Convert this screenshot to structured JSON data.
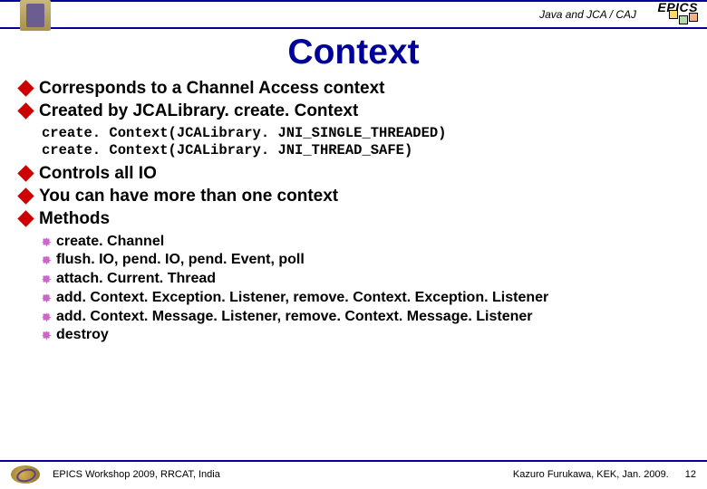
{
  "header": {
    "subtitle": "Java and JCA / CAJ",
    "badge": "EPICS"
  },
  "title": "Context",
  "bullets1a": [
    "Corresponds to a Channel Access context",
    "Created by JCALibrary. create. Context"
  ],
  "code": [
    "create. Context(JCALibrary. JNI_SINGLE_THREADED)",
    "create. Context(JCALibrary. JNI_THREAD_SAFE)"
  ],
  "bullets1b": [
    "Controls all IO",
    "You can have more than one context",
    "Methods"
  ],
  "bullets2": [
    "create. Channel",
    "flush. IO, pend. IO, pend. Event, poll",
    "attach. Current. Thread",
    "add. Context. Exception. Listener, remove. Context. Exception. Listener",
    "add. Context. Message. Listener, remove. Context. Message. Listener",
    "destroy"
  ],
  "footer": {
    "left": "EPICS Workshop 2009, RRCAT, India",
    "right": "Kazuro Furukawa, KEK, Jan. 2009.",
    "page": "12"
  }
}
